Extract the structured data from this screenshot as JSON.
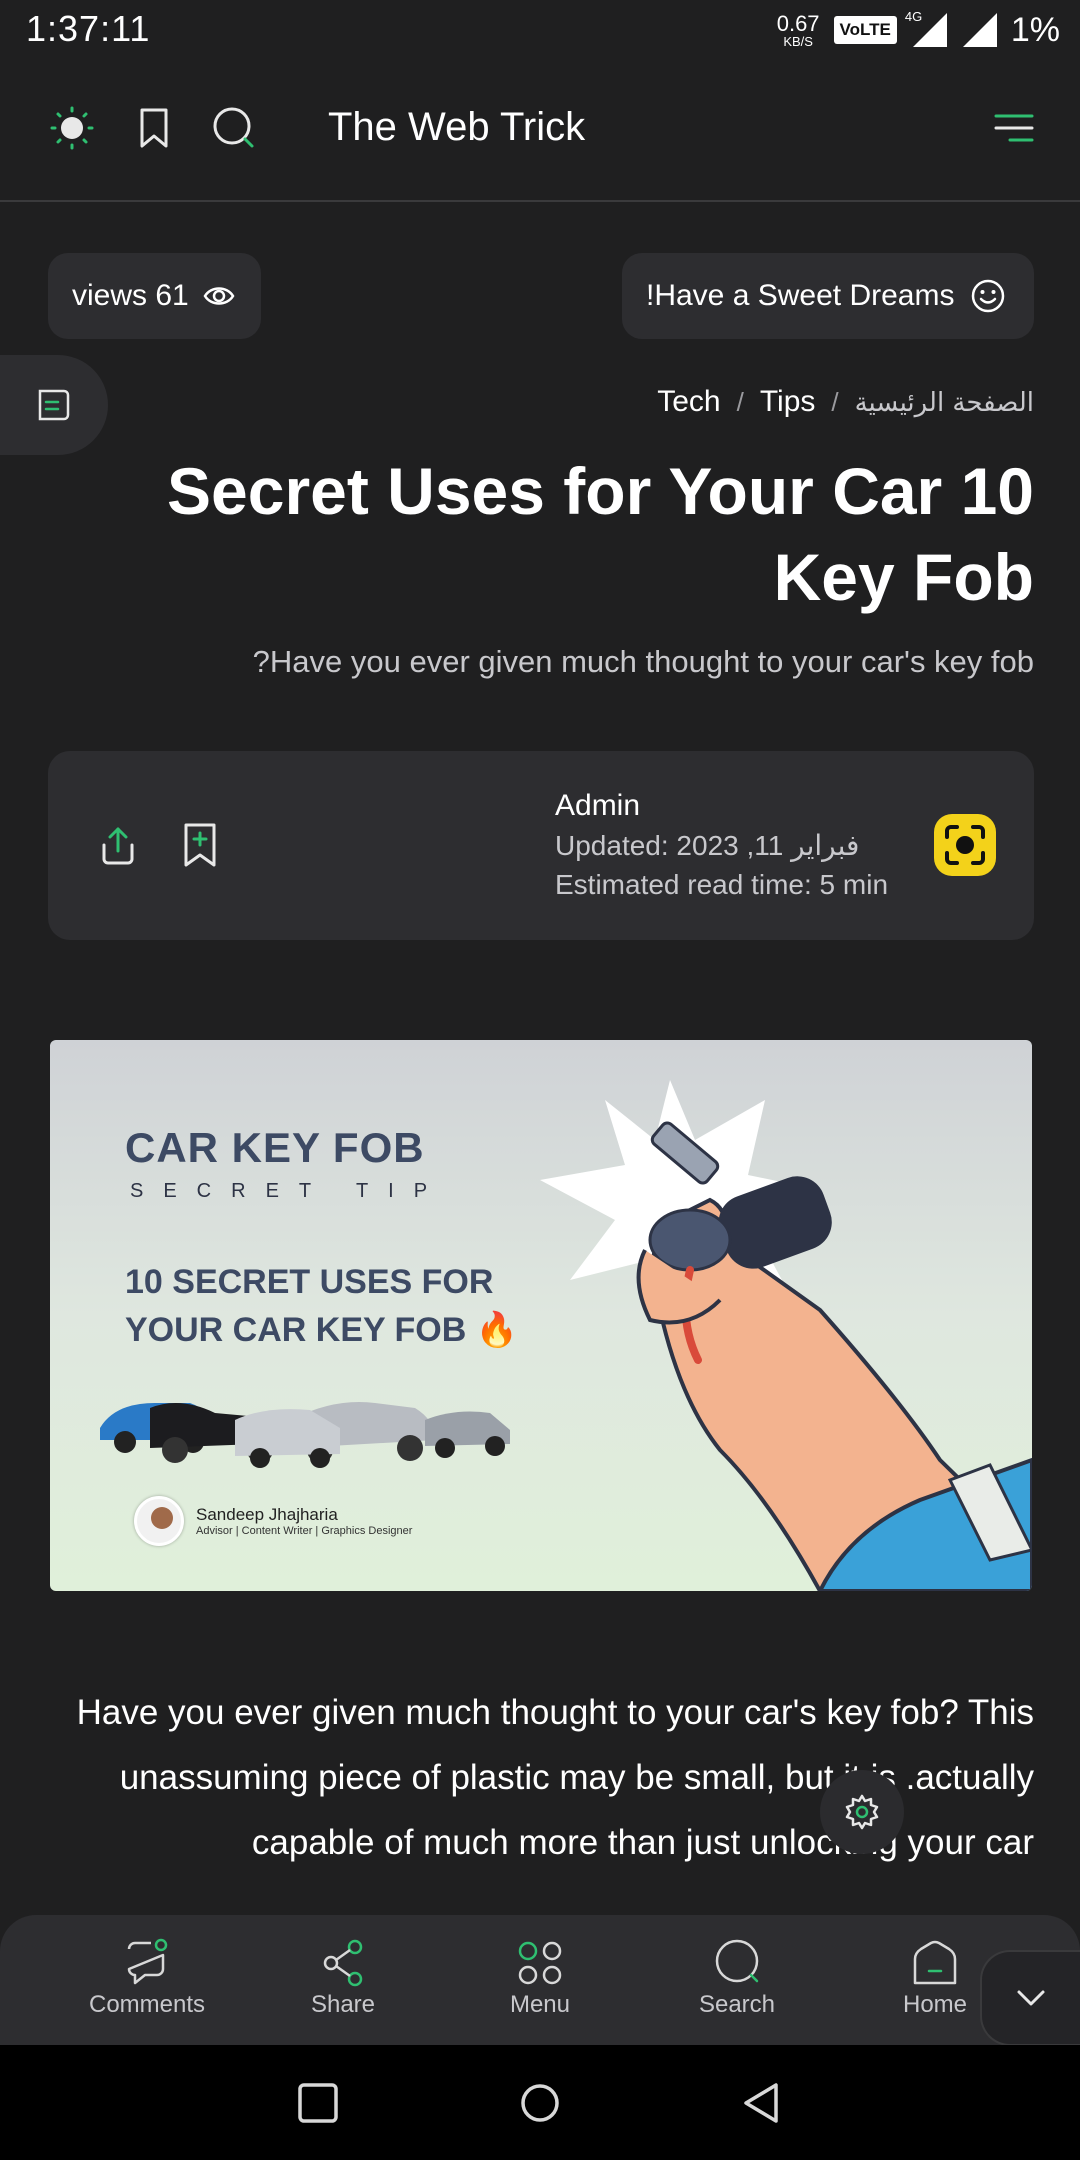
{
  "status_bar": {
    "time": "1:37:11",
    "speed_value": "0.67",
    "speed_unit": "KB/S",
    "volte": "VoLTE",
    "network": "4G",
    "battery": "1%"
  },
  "header": {
    "title": "The Web Trick",
    "accent_color": "#2fbf71"
  },
  "pills": {
    "views": "views 61",
    "greeting": "!Have a Sweet Dreams"
  },
  "breadcrumb": {
    "items": [
      "Tech",
      "Tips",
      "الصفحة الرئيسية"
    ],
    "separator": "/"
  },
  "article": {
    "title": "Secret Uses for Your Car 10 Key Fob",
    "subtitle": "?Have you ever given much thought to your car's key fob",
    "author": "Admin",
    "updated": "Updated: 2023 ,11 فبراير",
    "read_time": "Estimated read time: 5 min",
    "body": "Have you ever given much thought to your car's key fob? This unassuming piece of plastic may be small, but it is .actually capable of much more than just unlocking your car"
  },
  "hero_image": {
    "heading": "CAR KEY FOB",
    "tagline": "SECRET TIP",
    "headline_line1": "10 SECRET USES FOR",
    "headline_line2": "YOUR CAR KEY FOB 🔥",
    "person_name": "Sandeep Jhajharia",
    "person_role": "Advisor | Content Writer | Graphics Designer"
  },
  "bottom_nav": {
    "items": [
      {
        "label": "Comments",
        "icon": "comment-icon"
      },
      {
        "label": "Share",
        "icon": "share-icon"
      },
      {
        "label": "Menu",
        "icon": "menu-grid-icon"
      },
      {
        "label": "Search",
        "icon": "search-icon"
      },
      {
        "label": "Home",
        "icon": "home-icon"
      }
    ]
  }
}
